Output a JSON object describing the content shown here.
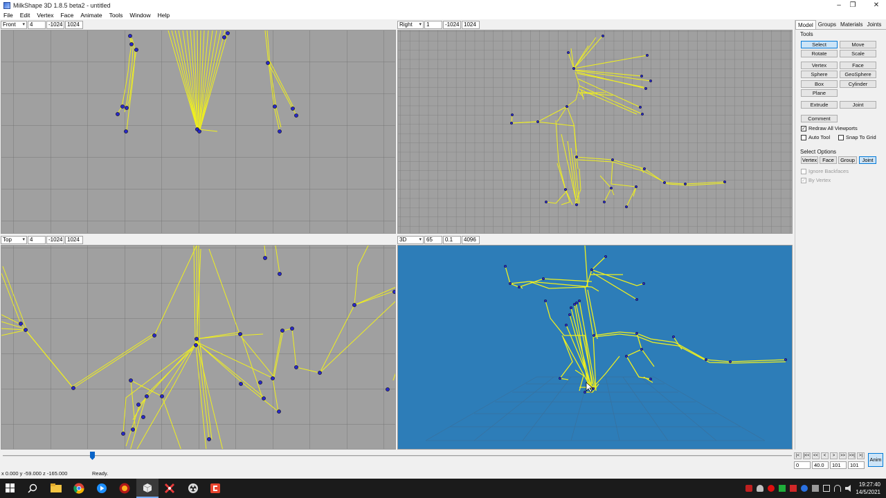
{
  "window": {
    "title": "MilkShape 3D 1.8.5 beta2 - untitled",
    "minimize": "–",
    "maximize": "❐",
    "close": "✕"
  },
  "menu": [
    "File",
    "Edit",
    "Vertex",
    "Face",
    "Animate",
    "Tools",
    "Window",
    "Help"
  ],
  "viewports": {
    "front": {
      "view": "Front",
      "zoom": "4",
      "min": "-1024",
      "max": "1024"
    },
    "right": {
      "view": "Right",
      "zoom": "1",
      "min": "-1024",
      "max": "1024"
    },
    "top": {
      "view": "Top",
      "zoom": "4",
      "min": "-1024",
      "max": "1024"
    },
    "persp": {
      "view": "3D",
      "fov": "65",
      "near": "0.1",
      "far": "4096"
    }
  },
  "panel": {
    "tabs": [
      "Model",
      "Groups",
      "Materials",
      "Joints"
    ],
    "tools_label": "Tools",
    "tools": [
      "Select",
      "Move",
      "Rotate",
      "Scale",
      "Vertex",
      "Face",
      "Sphere",
      "GeoSphere",
      "Box",
      "Cylinder",
      "Plane",
      "Extrude",
      "Joint",
      "Comment"
    ],
    "redraw_all": "Redraw All Viewports",
    "auto_tool": "Auto Tool",
    "snap_grid": "Snap To Grid",
    "select_options_label": "Select Options",
    "select_modes": [
      "Vertex",
      "Face",
      "Group",
      "Joint"
    ],
    "ignore_backfaces": "Ignore Backfaces",
    "by_vertex": "By Vertex"
  },
  "status": {
    "coords": "x 0.000 y -59.000 z -165.000",
    "message": "Ready."
  },
  "anim": {
    "nav": [
      "|<",
      "|<<",
      "<<",
      "<",
      ">",
      ">>",
      ">>|",
      ">|"
    ],
    "frame": "0",
    "fps": "40.0",
    "current": "101",
    "total": "101",
    "anim_button": "Anim"
  },
  "clock": {
    "time": "19:27:40",
    "date": "14/5/2021"
  },
  "colors": {
    "viewport_gray": "#a0a0a0",
    "persp_blue": "#2d7db8",
    "bone_yellow": "#f0f01e",
    "joint_blue": "#2828c8"
  }
}
